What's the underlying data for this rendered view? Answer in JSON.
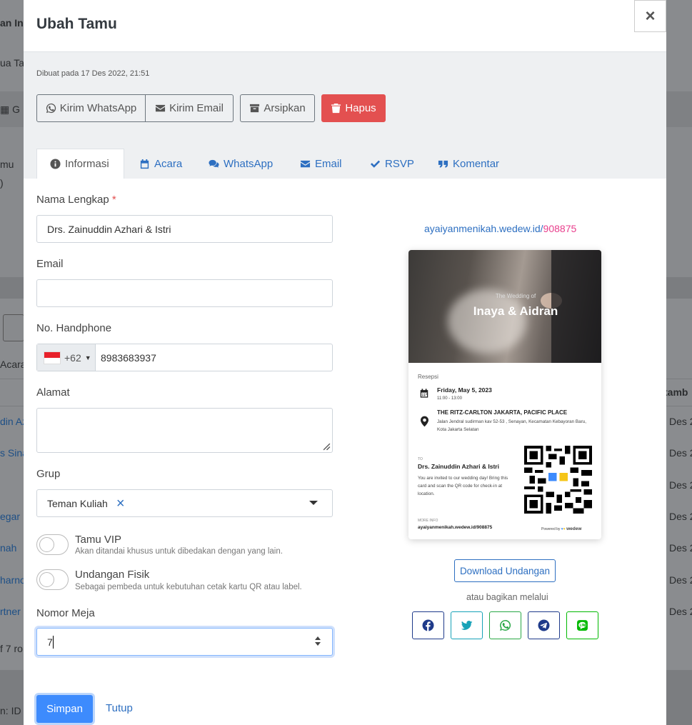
{
  "background": {
    "texts": [
      "an In",
      "ua Ta",
      "G",
      "mu",
      ")",
      "Acara",
      "tamb",
      "din Az",
      "s Sina",
      "egar",
      "nah",
      "harno",
      "rtner",
      "f 7 ro",
      "n: ID -"
    ],
    "dates": [
      "Des 2",
      "Des 2",
      "Des 2",
      "Des 2",
      "Des 2",
      "Des 2",
      "Des 2"
    ]
  },
  "modal": {
    "title": "Ubah Tamu",
    "close_symbol": "×",
    "created": "Dibuat pada 17 Des 2022, 21:51",
    "actions": {
      "whatsapp": "Kirim WhatsApp",
      "email": "Kirim Email",
      "archive": "Arsipkan",
      "delete": "Hapus"
    },
    "tabs": [
      "Informasi",
      "Acara",
      "WhatsApp",
      "Email",
      "RSVP",
      "Komentar"
    ],
    "form": {
      "name_label": "Nama Lengkap",
      "required_mark": "*",
      "name_value": "Drs. Zainuddin Azhari & Istri",
      "email_label": "Email",
      "email_value": "",
      "phone_label": "No. Handphone",
      "phone_code": "+62",
      "phone_value": "8983683937",
      "address_label": "Alamat",
      "address_value": "",
      "group_label": "Grup",
      "group_value": "Teman Kuliah",
      "group_clear": "×",
      "vip_title": "Tamu VIP",
      "vip_desc": "Akan ditandai khusus untuk dibedakan dengan yang lain.",
      "physical_title": "Undangan Fisik",
      "physical_desc": "Sebagai pembeda untuk kebutuhan cetak kartu QR atau label.",
      "table_label": "Nomor Meja",
      "table_value": "7"
    },
    "invite": {
      "url_base": "ayaiyanmenikah.wedew.id/",
      "url_code": "908875",
      "card": {
        "subtitle": "The Wedding of",
        "title": "Inaya & Aidran",
        "event": "Resepsi",
        "date": "Friday, May 5, 2023",
        "time": "11:00 - 13:00",
        "venue": "THE RITZ-CARLTON JAKARTA, PACIFIC PLACE",
        "address": "Jalan Jendral sudirman kav 52-53 , Senayan, Kecamatan Kebayoran Baru, Kota Jakarta Selatan",
        "to_label": "TO",
        "guest": "Drs. Zainuddin Azhari & Istri",
        "message": "You are invited to our wedding day! Bring this card and scan the QR code for check-in at location.",
        "more_info": "MORE INFO",
        "link": "ayaiyanmenikah.wedew.id/908875",
        "powered": "Powered by",
        "brand": "wedew"
      },
      "download": "Download Undangan",
      "share_label": "atau bagikan melalui",
      "share": [
        {
          "icon": "facebook-icon",
          "color": "#1e3a8a"
        },
        {
          "icon": "twitter-icon",
          "color": "#17a2b8"
        },
        {
          "icon": "whatsapp-icon",
          "color": "#28a745"
        },
        {
          "icon": "telegram-icon",
          "color": "#1e3a8a"
        },
        {
          "icon": "line-icon",
          "color": "#00b900"
        }
      ]
    },
    "footer": {
      "save": "Simpan",
      "close": "Tutup"
    }
  }
}
